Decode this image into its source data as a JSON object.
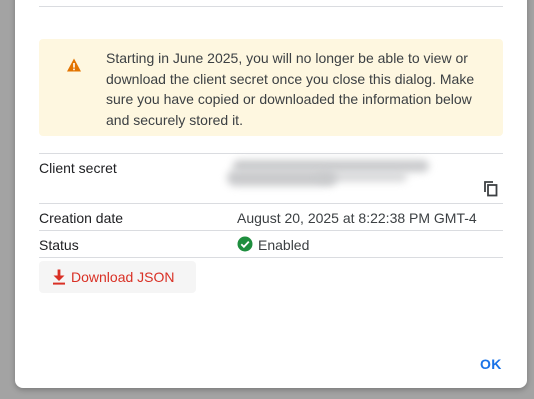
{
  "warning": {
    "icon": "warning-icon",
    "text": "Starting in June 2025, you will no longer be able to view or download the client secret once you close this dialog. Make sure you have copied or downloaded the information below and securely stored it."
  },
  "details": {
    "client_secret_label": "Client secret",
    "creation_date_label": "Creation date",
    "creation_date_value": "August 20, 2025 at 8:22:38 PM GMT-4",
    "status_label": "Status",
    "status_value": "Enabled"
  },
  "actions": {
    "download_label": "Download JSON",
    "ok_label": "OK"
  },
  "colors": {
    "warning_bg": "#fef7e0",
    "warning_icon": "#e37400",
    "status_green": "#1e8e3e",
    "download_red": "#d93025",
    "ok_blue": "#1a73e8"
  },
  "icons": {
    "copy": "copy-icon",
    "status": "check-circle-icon",
    "download": "download-icon"
  }
}
